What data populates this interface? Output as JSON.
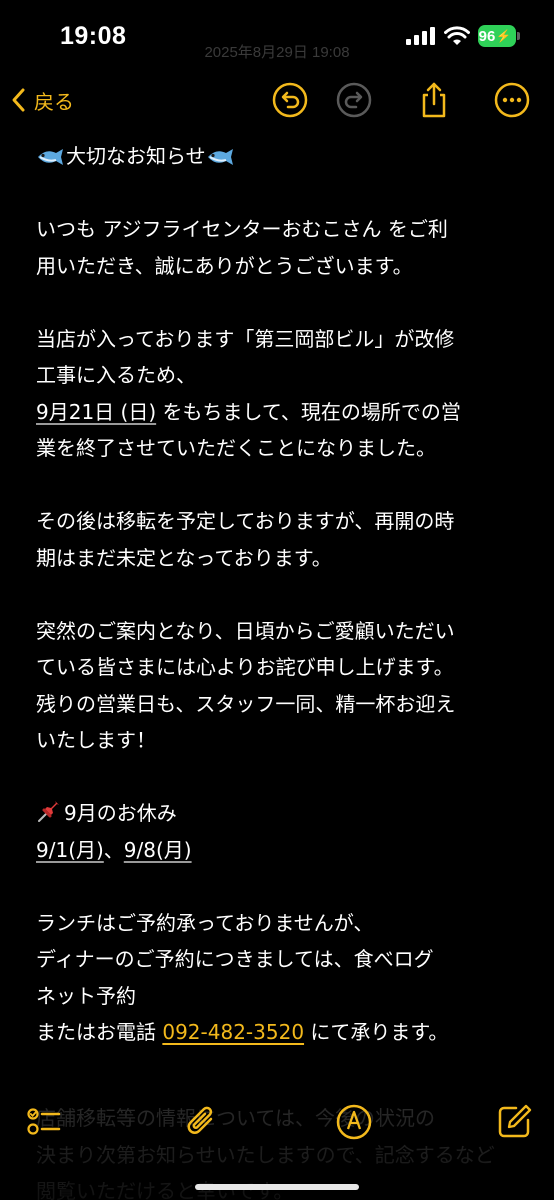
{
  "status_bar": {
    "time": "19:08",
    "battery": "96",
    "ghost_date": "2025年8月29日 19:08"
  },
  "nav": {
    "back_label": "戻る",
    "accent_color": "#f3b91c"
  },
  "note": {
    "paragraphs": [
      {
        "lines": [
          {
            "emoji": "fish",
            "text": "大切なお知らせ",
            "emoji_after": "fish"
          }
        ]
      },
      {
        "lines": [
          {
            "text": "いつも アジフライセンターおむこさん をご利"
          },
          {
            "text": "用いただき、誠にありがとうございます。"
          }
        ]
      },
      {
        "lines": [
          {
            "text": "当店が入っております「第三岡部ビル」が改修"
          },
          {
            "text": "工事に入るため、"
          },
          {
            "underlined": "9月21日 (日)",
            "text": " をもちまして、現在の場所での営"
          },
          {
            "text": "業を終了させていただくことになりました。"
          }
        ]
      },
      {
        "lines": [
          {
            "text": "その後は移転を予定しておりますが、再開の時"
          },
          {
            "text": "期はまだ未定となっております。"
          }
        ]
      },
      {
        "lines": [
          {
            "text": "突然のご案内となり、日頃からご愛顧いただい"
          },
          {
            "text": "ている皆さまには心よりお詫び申し上げます。"
          },
          {
            "text": "残りの営業日も、スタッフ一同、精一杯お迎え"
          },
          {
            "text": "いたします！"
          }
        ]
      },
      {
        "lines": [
          {
            "emoji": "pin",
            "text": "9月のお休み"
          },
          {
            "underlined": "9/1(月)",
            "text": "、",
            "underlined2": "9/8(月)"
          }
        ]
      },
      {
        "lines": [
          {
            "text": "ランチはご予約承っておりませんが、"
          },
          {
            "text": "ディナーのご予約につきましては、食べログ"
          },
          {
            "text": "ネット予約"
          },
          {
            "text": "またはお電話 ",
            "phone": "092-482-3520",
            "text_after": " にて承ります。"
          }
        ]
      }
    ],
    "faded_lines": [
      "店舗移転等の情報については、今後の状況の",
      "決まり次第お知らせいたしますので、記念するなど",
      "閲覧いただけると幸いです。"
    ]
  }
}
